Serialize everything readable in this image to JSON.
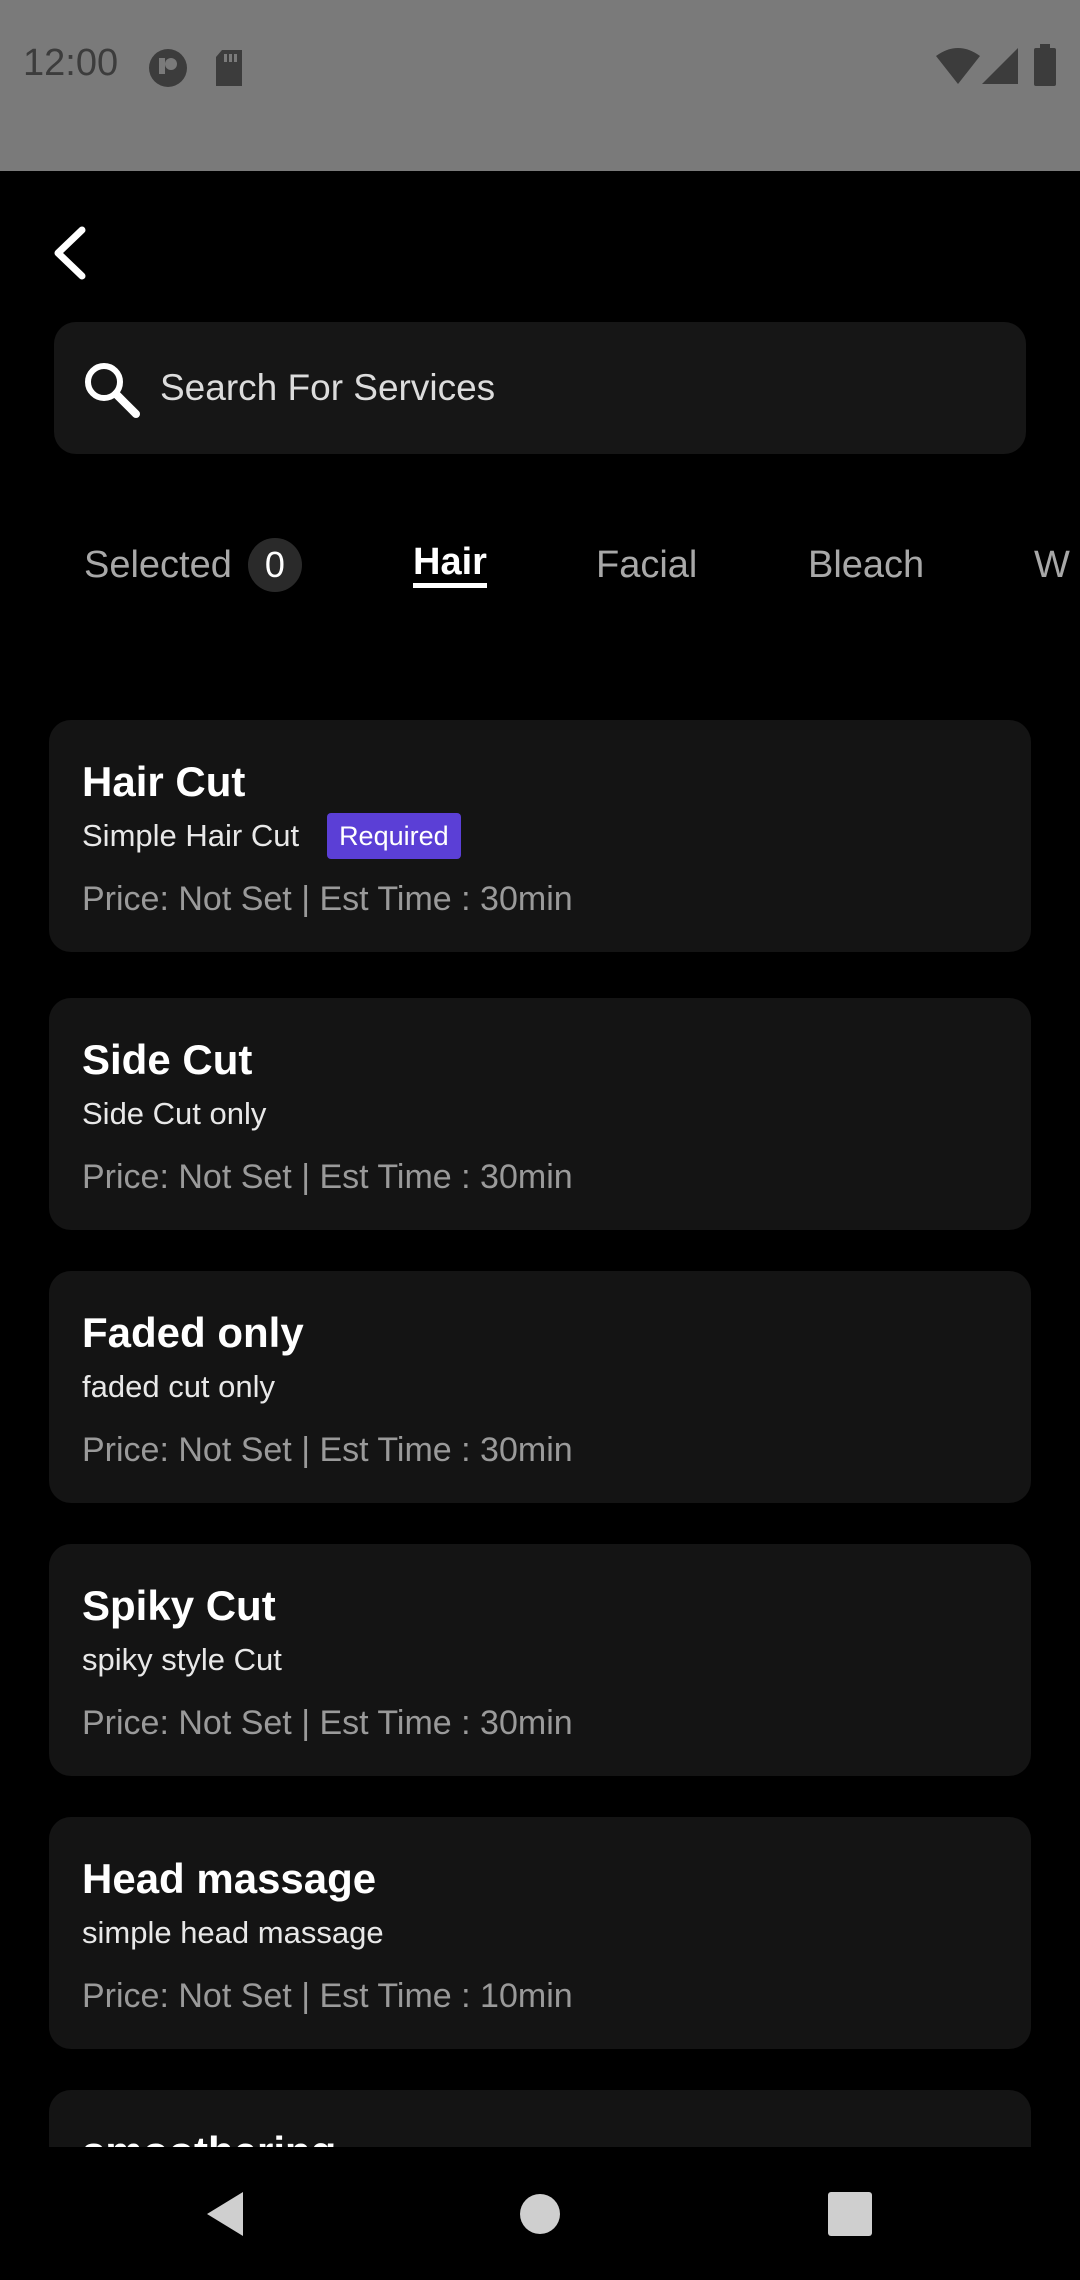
{
  "status_bar": {
    "time": "12:00",
    "icons_left": [
      "media-icon",
      "sd-card-icon"
    ],
    "icons_right": [
      "wifi-icon",
      "signal-icon",
      "battery-icon"
    ]
  },
  "header": {
    "back_icon": "chevron-left-icon"
  },
  "search": {
    "placeholder": "Search For Services",
    "value": ""
  },
  "tabs": [
    {
      "label": "Selected",
      "count": "0",
      "active": false
    },
    {
      "label": "Hair",
      "active": true
    },
    {
      "label": "Facial",
      "active": false
    },
    {
      "label": "Bleach",
      "active": false
    },
    {
      "label": "W",
      "active": false
    }
  ],
  "services": [
    {
      "title": "Hair Cut",
      "subtitle": "Simple Hair Cut",
      "badge": "Required",
      "meta": "Price: Not Set | Est Time : 30min"
    },
    {
      "title": "Side Cut",
      "subtitle": "Side Cut only",
      "meta": "Price: Not Set | Est Time : 30min"
    },
    {
      "title": "Faded only",
      "subtitle": "faded cut only",
      "meta": "Price: Not Set | Est Time : 30min"
    },
    {
      "title": "Spiky Cut",
      "subtitle": "spiky style Cut",
      "meta": "Price: Not Set | Est Time : 30min"
    },
    {
      "title": "Head massage",
      "subtitle": "simple head massage",
      "meta": "Price: Not Set | Est Time : 10min"
    },
    {
      "title": "smoothering",
      "subtitle": "",
      "meta": ""
    }
  ],
  "colors": {
    "background": "#000000",
    "card": "#141414",
    "accent_badge": "#5b3fd6",
    "status_bar": "#7a7a7a"
  },
  "nav_bar": {
    "buttons": [
      "back-triangle-icon",
      "home-circle-icon",
      "recents-square-icon"
    ]
  }
}
